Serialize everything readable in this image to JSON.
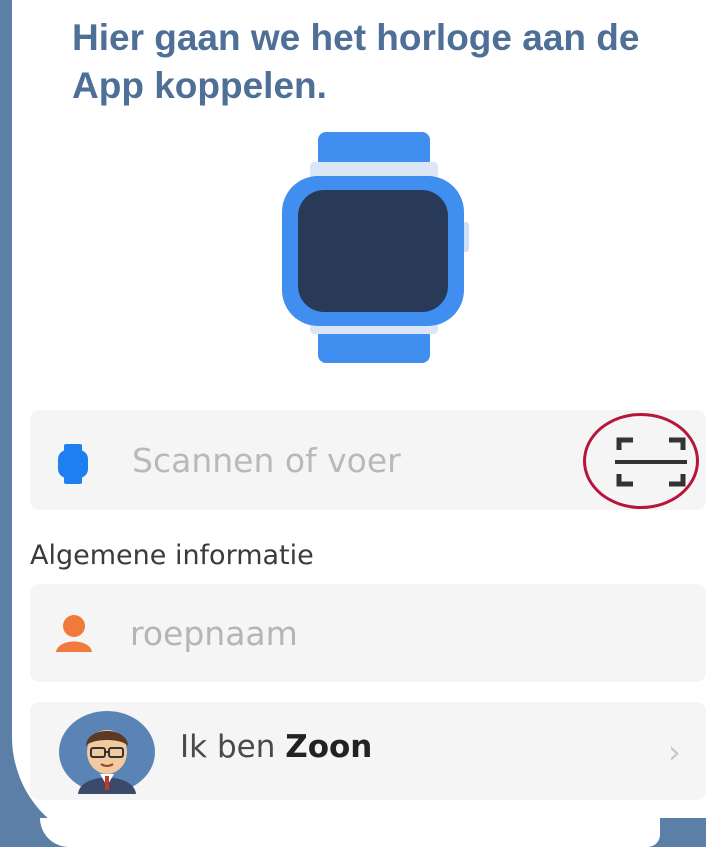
{
  "title": "Hier gaan we het horloge aan de App koppelen.",
  "scan_field": {
    "placeholder": "Scannen of voer"
  },
  "section_title": "Algemene informatie",
  "name_field": {
    "placeholder": "roepnaam"
  },
  "role_row": {
    "prefix": "Ik ben",
    "role": "Zoon"
  },
  "colors": {
    "title": "#4e6f96",
    "frame": "#5b7fa6",
    "watch_band": "#3f8ef0",
    "watch_screen": "#283a58",
    "highlight_circle": "#b5163a",
    "person_icon": "#f07a3c"
  },
  "icons": [
    "watch-illustration",
    "watch-small-icon",
    "scan-qr-icon",
    "person-icon",
    "avatar",
    "chevron-right-icon"
  ]
}
